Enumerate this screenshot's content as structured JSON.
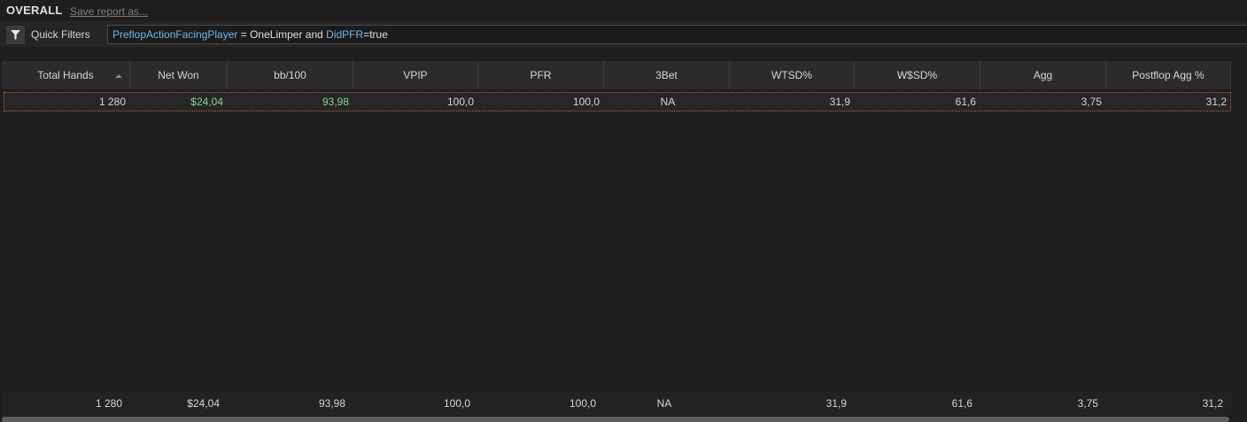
{
  "report": {
    "title": "OVERALL",
    "save_label": "Save report as..."
  },
  "filters": {
    "label": "Quick Filters",
    "expression": {
      "field1": "PreflopActionFacingPlayer",
      "op1": " = ",
      "value1": "OneLimper",
      "joiner": " and ",
      "field2": "DidPFR",
      "op2": "=",
      "value2": "true"
    }
  },
  "table": {
    "columns": [
      "Total Hands",
      "Net Won",
      "bb/100",
      "VPIP",
      "PFR",
      "3Bet",
      "WTSD%",
      "W$SD%",
      "Agg",
      "Postflop Agg %"
    ],
    "sorted_column": "Total Hands",
    "sort_direction": "ascending",
    "rows": [
      [
        "1 280",
        "$24,04",
        "93,98",
        "100,0",
        "100,0",
        "NA",
        "31,9",
        "61,6",
        "3,75",
        "31,2"
      ]
    ],
    "totals": [
      "1 280",
      "$24,04",
      "93,98",
      "100,0",
      "100,0",
      "NA",
      "31,9",
      "61,6",
      "3,75",
      "31,2"
    ]
  },
  "colors": {
    "positive": "#86d68a",
    "filter_keyword": "#6cb7f0",
    "selection_border": "#b5643a"
  },
  "icons": {
    "filter": "funnel-icon",
    "sort": "sort-ascending-icon"
  }
}
